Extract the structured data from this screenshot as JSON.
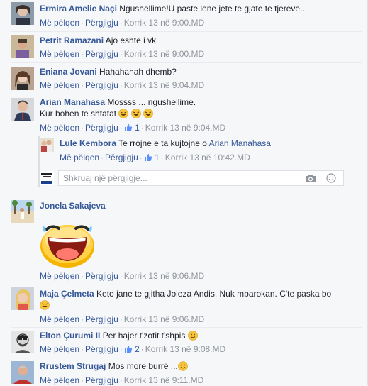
{
  "comments": [
    {
      "name": "Ermira Amelie Naçi",
      "text": "Ngushellime!U paste lene jete te gjate te tjereve...",
      "like_label": "Më pëlqen",
      "reply_label": "Përgjigju",
      "date": "Korrik 13 në 9:00.MD"
    },
    {
      "name": "Petrit Ramazani",
      "text": "Ajo eshte i vk",
      "like_label": "Më pëlqen",
      "reply_label": "Përgjigju",
      "date": "Korrik 13 në 9:00.MD"
    },
    {
      "name": "Eniana Jovani",
      "text": "Hahahahah dhemb?",
      "like_label": "Më pëlqen",
      "reply_label": "Përgjigju",
      "date": "Korrik 13 në 9:04.MD"
    },
    {
      "name": "Arian Manahasa",
      "text_line1": "Mossss ... ngushellime.",
      "text_line2": "Kur bohen te shtatat",
      "like_label": "Më pëlqen",
      "reply_label": "Përgjigju",
      "like_count": "1",
      "date": "Korrik 13 në 9:04.MD"
    },
    {
      "name": "Jonela Sakajeva",
      "like_label": "Më pëlqen",
      "reply_label": "Përgjigju",
      "date": "Korrik 13 në 9:06.MD"
    },
    {
      "name": "Maja Çelmeta",
      "text": "Keto jane te gjitha Joleza Andis. Nuk mbarokan. C'te paska bo",
      "like_label": "Më pëlqen",
      "reply_label": "Përgjigju",
      "date": "Korrik 13 në 9:06.MD"
    },
    {
      "name": "Elton Çurumi II",
      "text": "Per hajer t'zotit t'shpis",
      "like_label": "Më pëlqen",
      "reply_label": "Përgjigju",
      "like_count": "2",
      "date": "Korrik 13 në 9:08.MD"
    },
    {
      "name": "Rrustem Strugaj",
      "text": "Mos more burrë ...",
      "like_label": "Më pëlqen",
      "reply_label": "Përgjigju",
      "date": "Korrik 13 në 9:11.MD"
    }
  ],
  "reply": {
    "name": "Lule Kembora",
    "text": "Te rrojne e ta kujtojne o",
    "mention": "Arian Manahasa",
    "like_label": "Më pëlqen",
    "reply_label": "Përgjigju",
    "like_count": "1",
    "date": "Korrik 13 në 10:42.MD"
  },
  "reply_input": {
    "placeholder": "Shkruaj një përgjigje..."
  },
  "colors": {
    "link": "#365899",
    "meta": "#90949c",
    "text": "#1d2129",
    "background": "#f6f7f9"
  }
}
